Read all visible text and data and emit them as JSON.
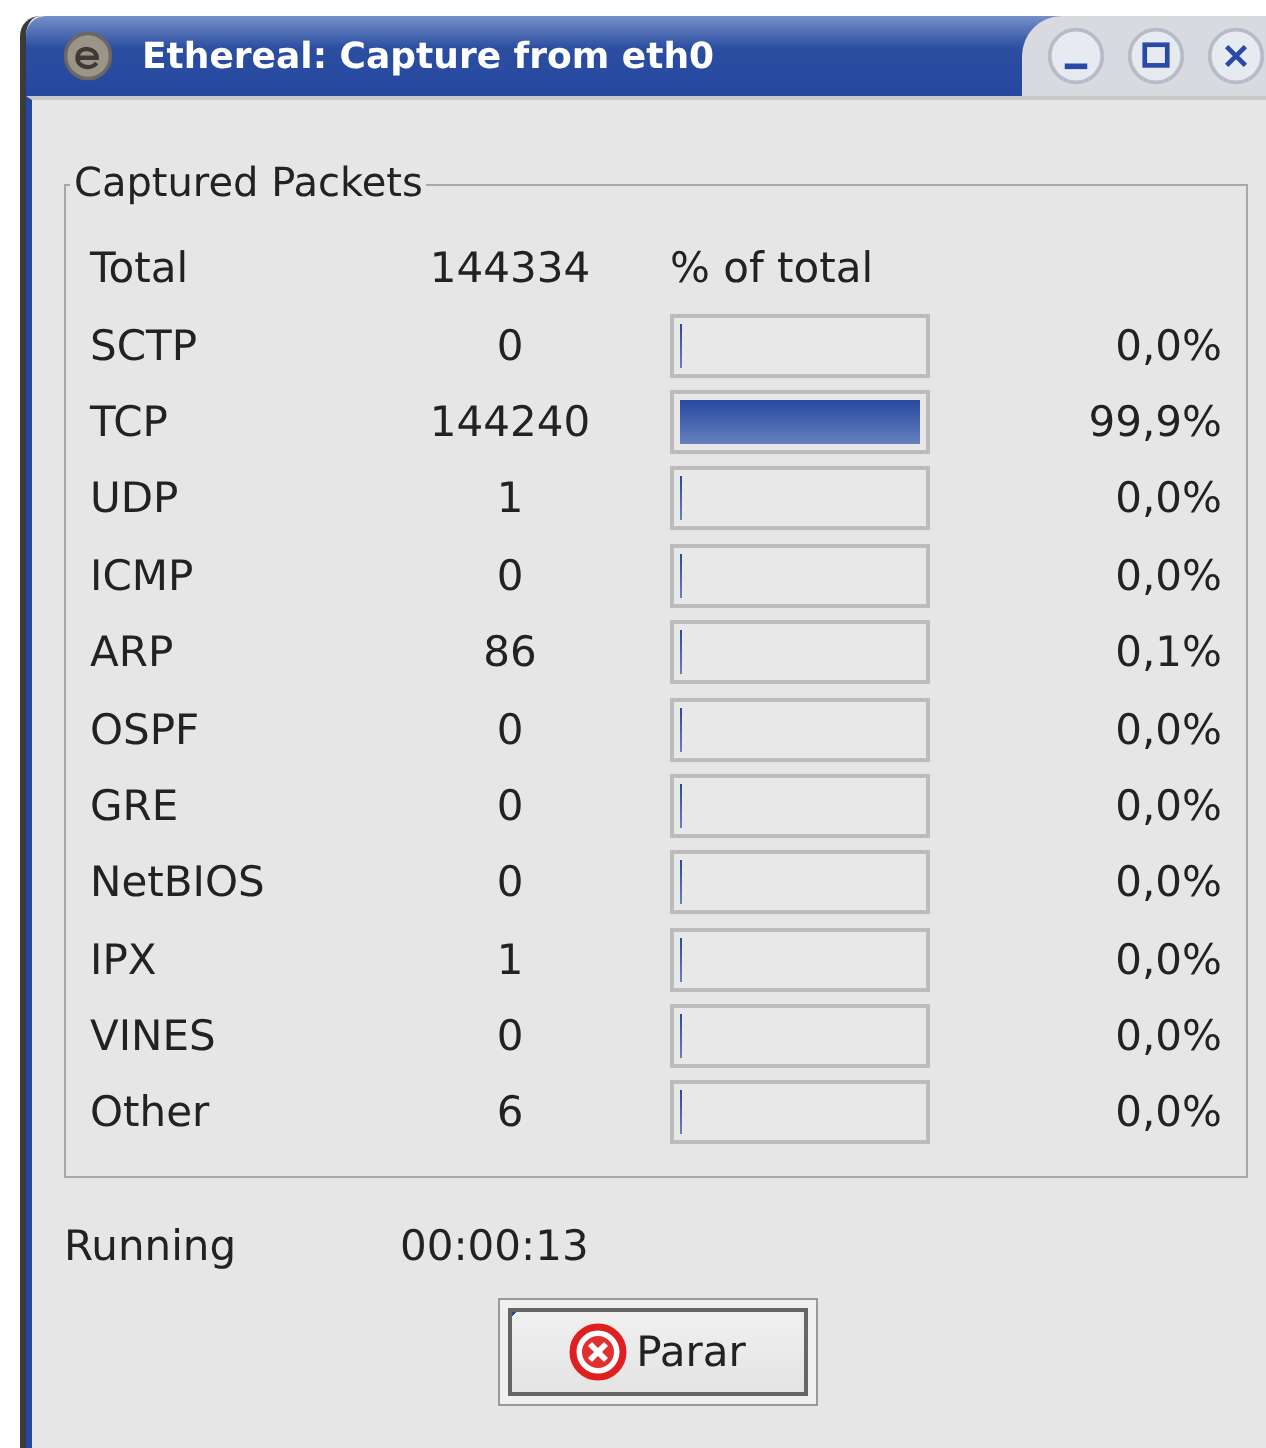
{
  "window": {
    "title": "Ethereal: Capture from eth0"
  },
  "captured_packets": {
    "title": "Captured Packets",
    "header": {
      "name": "Total",
      "count": "144334",
      "bar_heading": "% of total"
    },
    "rows": [
      {
        "name": "SCTP",
        "count": "0",
        "level": 0,
        "percent": "0,0%"
      },
      {
        "name": "TCP",
        "count": "144240",
        "level": 0.999,
        "percent": "99,9%"
      },
      {
        "name": "UDP",
        "count": "1",
        "level": 0,
        "percent": "0,0%"
      },
      {
        "name": "ICMP",
        "count": "0",
        "level": 0,
        "percent": "0,0%"
      },
      {
        "name": "ARP",
        "count": "86",
        "level": 0.001,
        "percent": "0,1%"
      },
      {
        "name": "OSPF",
        "count": "0",
        "level": 0,
        "percent": "0,0%"
      },
      {
        "name": "GRE",
        "count": "0",
        "level": 0,
        "percent": "0,0%"
      },
      {
        "name": "NetBIOS",
        "count": "0",
        "level": 0,
        "percent": "0,0%"
      },
      {
        "name": "IPX",
        "count": "1",
        "level": 0,
        "percent": "0,0%"
      },
      {
        "name": "VINES",
        "count": "0",
        "level": 0,
        "percent": "0,0%"
      },
      {
        "name": "Other",
        "count": "6",
        "level": 0,
        "percent": "0,0%"
      }
    ]
  },
  "running": {
    "label": "Running",
    "time": "00:00:13"
  },
  "buttons": [
    {
      "label": "Parar",
      "focused": true
    }
  ]
}
